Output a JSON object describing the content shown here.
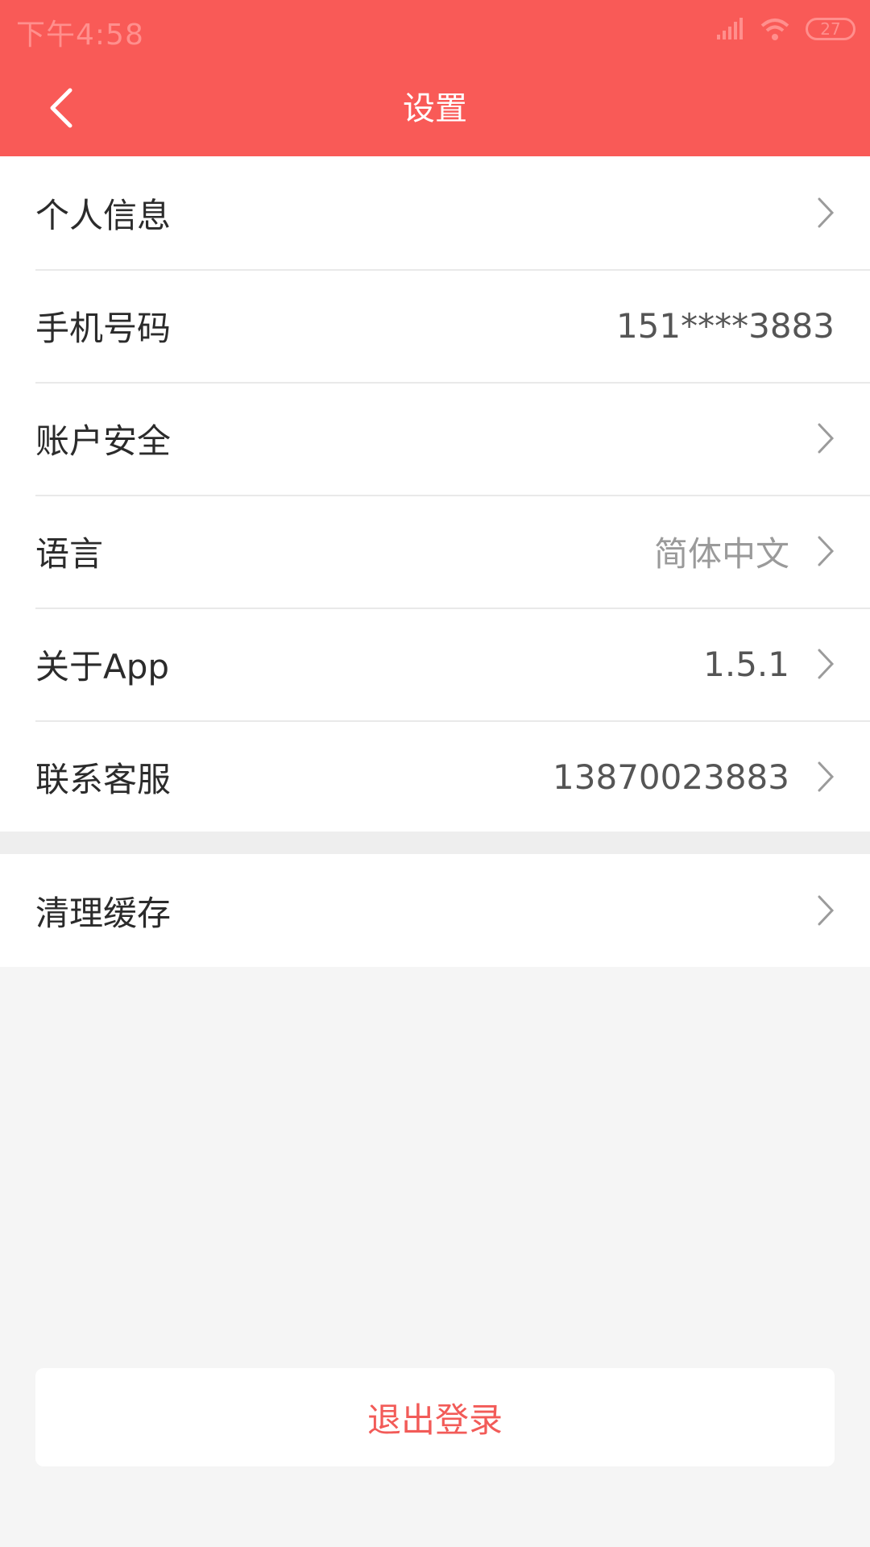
{
  "status_bar": {
    "time": "下午4:58",
    "battery": "27"
  },
  "header": {
    "title": "设置"
  },
  "settings": {
    "items": [
      {
        "label": "个人信息",
        "value": "",
        "chevron": true
      },
      {
        "label": "手机号码",
        "value": "151****3883",
        "chevron": false
      },
      {
        "label": "账户安全",
        "value": "",
        "chevron": true
      },
      {
        "label": "语言",
        "value": "简体中文",
        "chevron": true
      },
      {
        "label": "关于App",
        "value": "1.5.1",
        "chevron": true
      },
      {
        "label": "联系客服",
        "value": "13870023883",
        "chevron": true
      }
    ],
    "cache": {
      "label": "清理缓存"
    }
  },
  "actions": {
    "logout_label": "退出登录"
  },
  "colors": {
    "accent": "#f95a57",
    "logout_text": "#f25b58"
  }
}
